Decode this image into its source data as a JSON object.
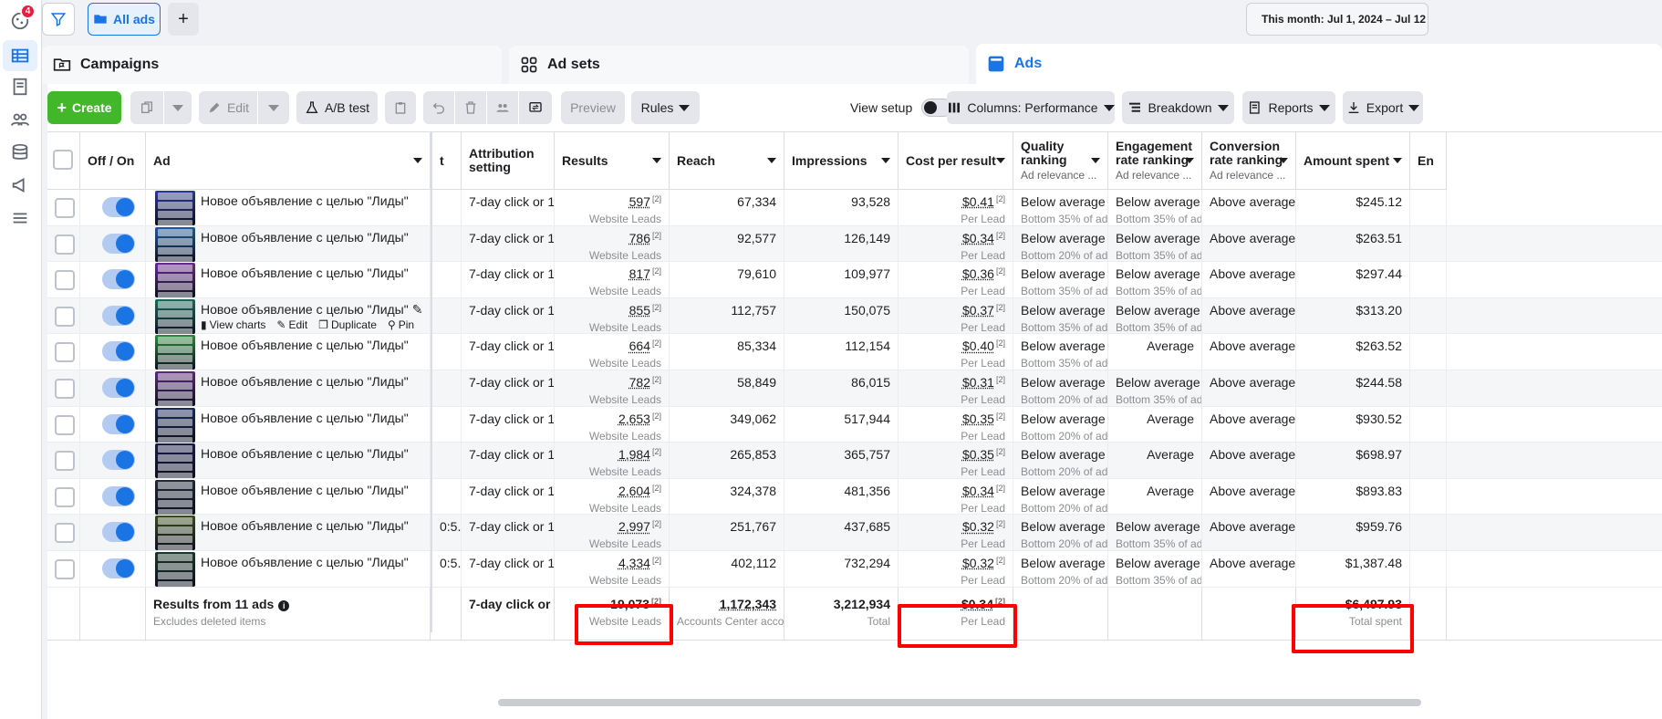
{
  "rail": {
    "notification_count": "4"
  },
  "topbar": {
    "tab_label": "All ads",
    "date_range": "This month: Jul 1, 2024 – Jul 12"
  },
  "levels": {
    "campaigns": "Campaigns",
    "adsets": "Ad sets",
    "ads": "Ads"
  },
  "toolbar": {
    "create": "Create",
    "edit": "Edit",
    "abtest": "A/B test",
    "preview": "Preview",
    "rules": "Rules",
    "view_setup": "View setup",
    "columns": "Columns: Performance",
    "breakdown": "Breakdown",
    "reports": "Reports",
    "export": "Export"
  },
  "headers": {
    "off_on": "Off / On",
    "ad": "Ad",
    "partial": "t",
    "attribution": "Attribution setting",
    "results": "Results",
    "reach": "Reach",
    "impressions": "Impressions",
    "cpr": "Cost per result",
    "quality": "Quality ranking",
    "quality_sub": "Ad relevance ...",
    "engagement": "Engagement rate ranking",
    "engagement_sub": "Ad relevance ...",
    "conversion": "Conversion rate ranking",
    "conversion_sub": "Ad relevance ...",
    "amount": "Amount spent",
    "next": "En"
  },
  "row_actions": {
    "view_charts": "View charts",
    "edit": "Edit",
    "duplicate": "Duplicate",
    "pin": "Pin"
  },
  "rows": [
    {
      "name": "Новое объявление с целью \"Лиды\"",
      "partial": "",
      "attr": "7-day click or 1...",
      "results": "597",
      "results_sub": "Website Leads",
      "reach": "67,334",
      "impr": "93,528",
      "cpr": "$0.41",
      "cpr_sub": "Per Lead",
      "quality": "Below average",
      "quality_sub": "Bottom 35% of ads",
      "eng": "Below average",
      "eng_sub": "Bottom 35% of ads",
      "conv": "Above average",
      "amount": "$245.12",
      "thumb": "#2a3a8f"
    },
    {
      "name": "Новое объявление с целью \"Лиды\"",
      "partial": "",
      "attr": "7-day click or 1...",
      "results": "786",
      "results_sub": "Website Leads",
      "reach": "92,577",
      "impr": "126,149",
      "cpr": "$0.34",
      "cpr_sub": "Per Lead",
      "quality": "Below average",
      "quality_sub": "Bottom 20% of ads",
      "eng": "Below average",
      "eng_sub": "Bottom 35% of ads",
      "conv": "Above average",
      "amount": "$263.51",
      "thumb": "#1e5a9c"
    },
    {
      "name": "Новое объявление с целью \"Лиды\"",
      "partial": "",
      "attr": "7-day click or 1...",
      "results": "817",
      "results_sub": "Website Leads",
      "reach": "79,610",
      "impr": "109,977",
      "cpr": "$0.36",
      "cpr_sub": "Per Lead",
      "quality": "Below average",
      "quality_sub": "Bottom 35% of ads",
      "eng": "Below average",
      "eng_sub": "Bottom 35% of ads",
      "conv": "Above average",
      "amount": "$297.44",
      "thumb": "#6a2a8f"
    },
    {
      "name": "Новое объявление с целью \"Лиды\"",
      "partial": "",
      "attr": "7-day click or 1...",
      "results": "855",
      "results_sub": "Website Leads",
      "reach": "112,757",
      "impr": "150,075",
      "cpr": "$0.37",
      "cpr_sub": "Per Lead",
      "quality": "Below average",
      "quality_sub": "Bottom 35% of ads",
      "eng": "Below average",
      "eng_sub": "Bottom 35% of ads",
      "conv": "Above average",
      "amount": "$313.20",
      "thumb": "#1a6a5a"
    },
    {
      "name": "Новое объявление с целью \"Лиды\"",
      "partial": "",
      "attr": "7-day click or 1...",
      "results": "664",
      "results_sub": "Website Leads",
      "reach": "85,334",
      "impr": "112,154",
      "cpr": "$0.40",
      "cpr_sub": "Per Lead",
      "quality": "Below average",
      "quality_sub": "Bottom 35% of ads",
      "eng": "Average",
      "eng_sub": "",
      "conv": "Above average",
      "amount": "$263.52",
      "thumb": "#2a8a3a"
    },
    {
      "name": "Новое объявление с целью \"Лиды\"",
      "partial": "",
      "attr": "7-day click or 1...",
      "results": "782",
      "results_sub": "Website Leads",
      "reach": "58,849",
      "impr": "86,015",
      "cpr": "$0.31",
      "cpr_sub": "Per Lead",
      "quality": "Below average",
      "quality_sub": "Bottom 20% of ads",
      "eng": "Below average",
      "eng_sub": "Bottom 35% of ads",
      "conv": "Above average",
      "amount": "$244.58",
      "thumb": "#5a2a7a"
    },
    {
      "name": "Новое объявление с целью \"Лиды\"",
      "partial": "",
      "attr": "7-day click or 1...",
      "results": "2,653",
      "results_sub": "Website Leads",
      "reach": "349,062",
      "impr": "517,944",
      "cpr": "$0.35",
      "cpr_sub": "Per Lead",
      "quality": "Below average",
      "quality_sub": "Bottom 20% of ads",
      "eng": "Average",
      "eng_sub": "",
      "conv": "Above average",
      "amount": "$930.52",
      "thumb": "#1a2a5a"
    },
    {
      "name": "Новое объявление с целью \"Лиды\"",
      "partial": "",
      "attr": "7-day click or 1...",
      "results": "1,984",
      "results_sub": "Website Leads",
      "reach": "265,853",
      "impr": "365,757",
      "cpr": "$0.35",
      "cpr_sub": "Per Lead",
      "quality": "Below average",
      "quality_sub": "Bottom 20% of ads",
      "eng": "Average",
      "eng_sub": "",
      "conv": "Above average",
      "amount": "$698.97",
      "thumb": "#1a1a4a"
    },
    {
      "name": "Новое объявление с целью \"Лиды\"",
      "partial": "",
      "attr": "7-day click or 1...",
      "results": "2,604",
      "results_sub": "Website Leads",
      "reach": "324,378",
      "impr": "481,356",
      "cpr": "$0.34",
      "cpr_sub": "Per Lead",
      "quality": "Below average",
      "quality_sub": "Bottom 20% of ads",
      "eng": "Average",
      "eng_sub": "",
      "conv": "Above average",
      "amount": "$893.83",
      "thumb": "#202a3a"
    },
    {
      "name": "Новое объявление с целью \"Лиды\"",
      "partial": "0:5...",
      "attr": "7-day click or 1...",
      "results": "2,997",
      "results_sub": "Website Leads",
      "reach": "251,767",
      "impr": "437,685",
      "cpr": "$0.32",
      "cpr_sub": "Per Lead",
      "quality": "Below average",
      "quality_sub": "Bottom 20% of ads",
      "eng": "Below average",
      "eng_sub": "Bottom 35% of ads",
      "conv": "Above average",
      "amount": "$959.76",
      "thumb": "#3a4a1a"
    },
    {
      "name": "Новое объявление с целью \"Лиды\"",
      "partial": "0:5...",
      "attr": "7-day click or 1...",
      "results": "4,334",
      "results_sub": "Website Leads",
      "reach": "402,112",
      "impr": "732,294",
      "cpr": "$0.32",
      "cpr_sub": "Per Lead",
      "quality": "Below average",
      "quality_sub": "Bottom 20% of ads",
      "eng": "Below average",
      "eng_sub": "Bottom 35% of ads",
      "conv": "Above average",
      "amount": "$1,387.48",
      "thumb": "#1a3a2a"
    }
  ],
  "footnote": "[2]",
  "summary": {
    "label": "Results from 11 ads",
    "sub": "Excludes deleted items",
    "attr": "7-day click or ...",
    "results": "19,073",
    "results_sub": "Website Leads",
    "reach": "1,172,343",
    "reach_sub": "Accounts Center acco...",
    "impr": "3,212,934",
    "impr_sub": "Total",
    "cpr": "$0.34",
    "cpr_sub": "Per Lead",
    "amount": "$6,497.93",
    "amount_sub": "Total spent"
  },
  "colors": {
    "accent": "#1b74e4",
    "create": "#42b72a",
    "highlight": "#ff0000"
  }
}
